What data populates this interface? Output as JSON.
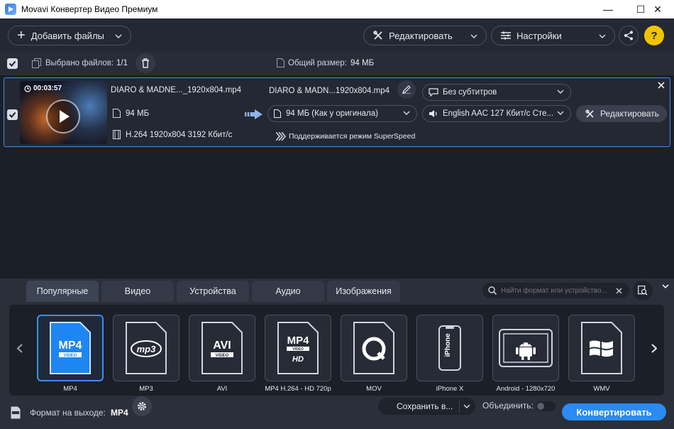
{
  "window": {
    "title": "Movavi Конвертер Видео Премиум",
    "minimize": "—",
    "maximize": "☐",
    "close": "✕"
  },
  "toolbar": {
    "add_files": "Добавить файлы",
    "edit": "Редактировать",
    "settings": "Настройки",
    "help": "?"
  },
  "selection": {
    "selected_label": "Выбрано файлов:",
    "selected_value": "1/1",
    "size_label": "Общий размер:",
    "size_value": "94 МБ"
  },
  "file": {
    "duration": "00:03:57",
    "source_name": "DIARO & MADNE..._1920x804.mp4",
    "source_size": "94 МБ",
    "source_codec": "H.264 1920x804 3192 Кбит/с",
    "output_name": "DIARO & MADN...1920x804.mp4",
    "output_size": "94 МБ (Как у оригинала)",
    "subtitles": "Без субтитров",
    "audio": "English AAC 127 Кбит/с Сте...",
    "superspeed": "Поддерживается режим SuperSpeed",
    "edit_button": "Редактировать"
  },
  "tabs": [
    {
      "label": "Популярные",
      "active": true
    },
    {
      "label": "Видео",
      "active": false
    },
    {
      "label": "Устройства",
      "active": false
    },
    {
      "label": "Аудио",
      "active": false
    },
    {
      "label": "Изображения",
      "active": false
    }
  ],
  "search": {
    "placeholder": "Найти формат или устройство..."
  },
  "formats": [
    {
      "label": "MP4",
      "icon": "mp4-icon",
      "selected": true
    },
    {
      "label": "MP3",
      "icon": "mp3-icon",
      "selected": false
    },
    {
      "label": "AVI",
      "icon": "avi-icon",
      "selected": false
    },
    {
      "label": "MP4 H.264 - HD 720p",
      "icon": "mp4-hd-icon",
      "selected": false
    },
    {
      "label": "MOV",
      "icon": "quicktime-icon",
      "selected": false
    },
    {
      "label": "iPhone X",
      "icon": "iphone-icon",
      "selected": false
    },
    {
      "label": "Android - 1280x720",
      "icon": "android-tablet-icon",
      "selected": false
    },
    {
      "label": "WMV",
      "icon": "windows-icon",
      "selected": false
    }
  ],
  "footer": {
    "output_label": "Формат на выходе:",
    "output_value": "MP4",
    "save_to": "Сохранить в...",
    "merge_label": "Объединить:",
    "convert": "Конвертировать"
  },
  "colors": {
    "accent": "#2a8bf2",
    "background": "#1b1f27",
    "panel": "#2a2f3a"
  }
}
